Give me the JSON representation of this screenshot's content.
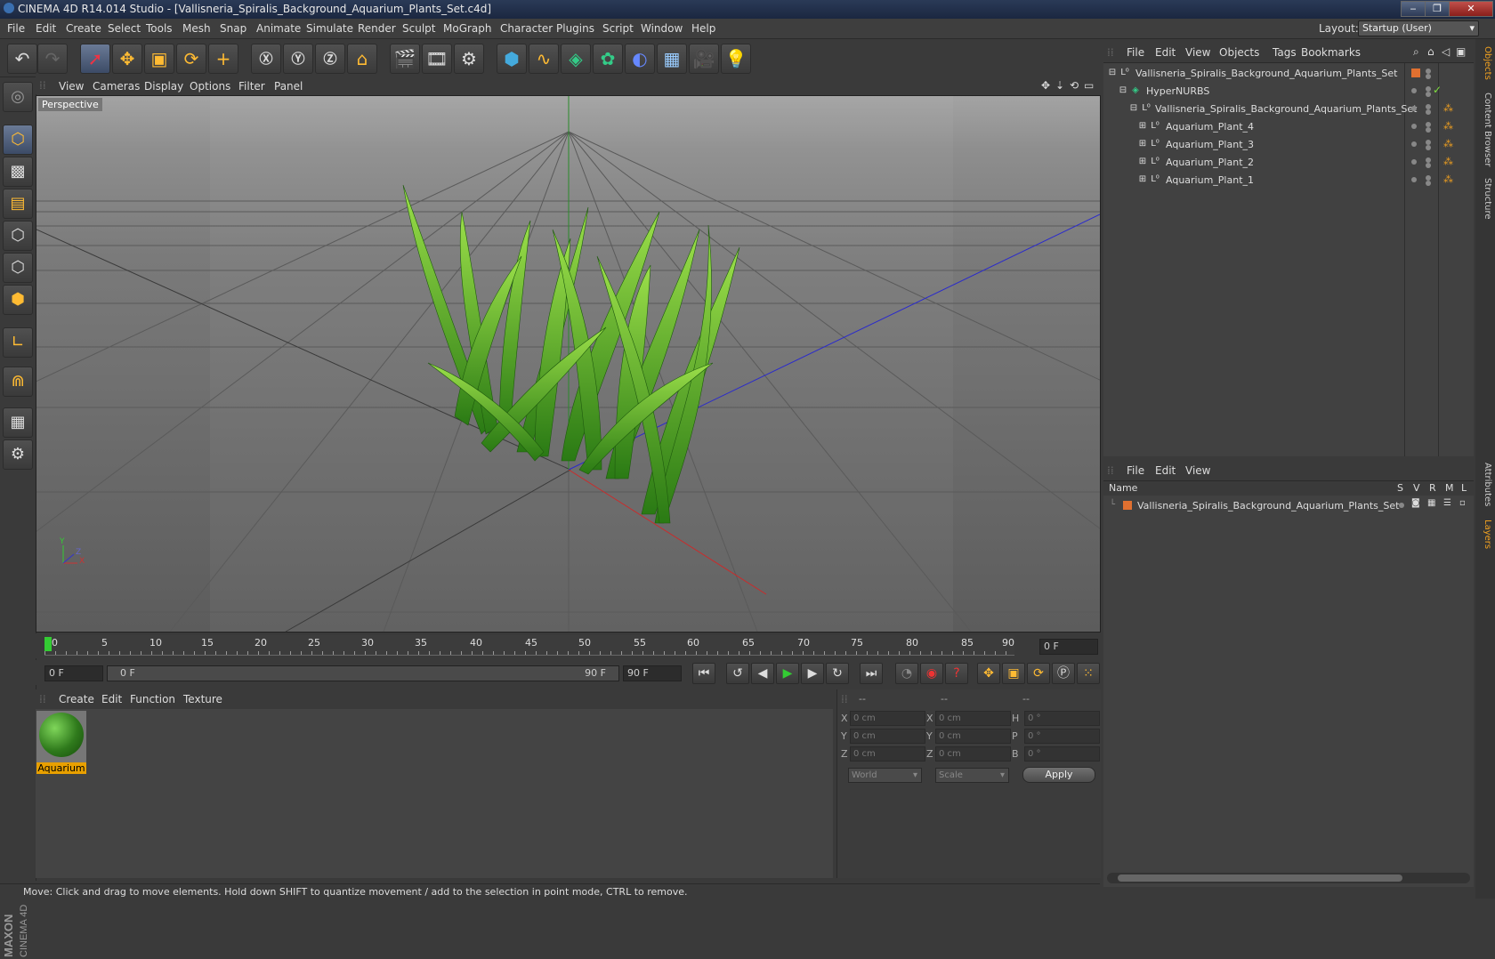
{
  "window": {
    "title": "CINEMA 4D R14.014 Studio - [Vallisneria_Spiralis_Background_Aquarium_Plants_Set.c4d]"
  },
  "menu": [
    "File",
    "Edit",
    "Create",
    "Select",
    "Tools",
    "Mesh",
    "Snap",
    "Animate",
    "Simulate",
    "Render",
    "Sculpt",
    "MoGraph",
    "Character",
    "Plugins",
    "Script",
    "Window",
    "Help"
  ],
  "layout": {
    "label": "Layout:",
    "value": "Startup (User)"
  },
  "viewport": {
    "menu": [
      "View",
      "Cameras",
      "Display",
      "Options",
      "Filter",
      "Panel"
    ],
    "label": "Perspective",
    "axis_y": "Y",
    "axis_x": "X",
    "axis_z": "Z"
  },
  "timeline": {
    "ticks": [
      "0",
      "5",
      "10",
      "15",
      "20",
      "25",
      "30",
      "35",
      "40",
      "45",
      "50",
      "55",
      "60",
      "65",
      "70",
      "75",
      "80",
      "85",
      "90"
    ],
    "current": "0 F",
    "start": "0 F",
    "range_start": "0 F",
    "range_end": "90 F",
    "end": "90 F"
  },
  "materials": {
    "menu": [
      "Create",
      "Edit",
      "Function",
      "Texture"
    ],
    "items": [
      {
        "name": "Aquarium"
      }
    ]
  },
  "coords": {
    "headers": [
      "--",
      "--",
      "--"
    ],
    "rows": [
      {
        "a": "X",
        "av": "0 cm",
        "b": "X",
        "bv": "0 cm",
        "c": "H",
        "cv": "0 °"
      },
      {
        "a": "Y",
        "av": "0 cm",
        "b": "Y",
        "bv": "0 cm",
        "c": "P",
        "cv": "0 °"
      },
      {
        "a": "Z",
        "av": "0 cm",
        "b": "Z",
        "bv": "0 cm",
        "c": "B",
        "cv": "0 °"
      }
    ],
    "world": "World",
    "scale": "Scale",
    "apply": "Apply"
  },
  "objects": {
    "menu": [
      "File",
      "Edit",
      "View",
      "Objects",
      "Tags",
      "Bookmarks"
    ],
    "items": [
      {
        "name": "Vallisneria_Spiralis_Background_Aquarium_Plants_Set"
      },
      {
        "name": "HyperNURBS"
      },
      {
        "name": "Vallisneria_Spiralis_Background_Aquarium_Plants_Set"
      },
      {
        "name": "Aquarium_Plant_4"
      },
      {
        "name": "Aquarium_Plant_3"
      },
      {
        "name": "Aquarium_Plant_2"
      },
      {
        "name": "Aquarium_Plant_1"
      }
    ]
  },
  "layers": {
    "menu": [
      "File",
      "Edit",
      "View"
    ],
    "header": {
      "name": "Name",
      "cols": [
        "S",
        "V",
        "R",
        "M",
        "L"
      ]
    },
    "items": [
      {
        "name": "Vallisneria_Spiralis_Background_Aquarium_Plants_Set",
        "color": "#e07030"
      }
    ]
  },
  "side_tabs": [
    "Objects",
    "Content Browser",
    "Structure",
    "Attributes",
    "Layers"
  ],
  "status": "Move: Click and drag to move elements. Hold down SHIFT to quantize movement / add to the selection in point mode, CTRL to remove.",
  "colors": {
    "accent": "#e8a000",
    "selection": "#f0a020",
    "ok": "#80e040"
  }
}
